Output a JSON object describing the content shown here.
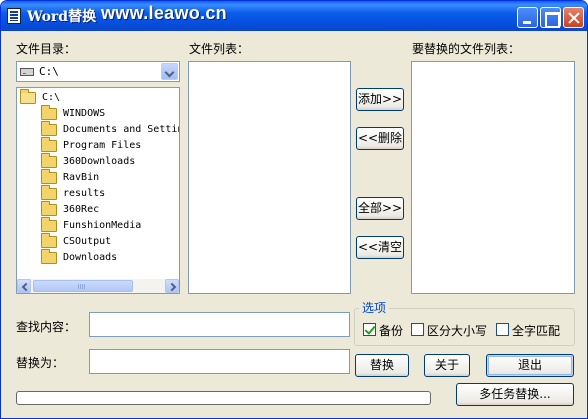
{
  "window": {
    "title": "Word替换",
    "url": "www.leawo.cn"
  },
  "labels": {
    "directory": "文件目录：",
    "file_list": "文件列表：",
    "replace_list": "要替换的文件列表：",
    "find": "查找内容：",
    "replace_with": "替换为："
  },
  "drive_combo": {
    "value": "C:\\"
  },
  "tree": {
    "root": "C:\\",
    "items": [
      "WINDOWS",
      "Documents and Settin",
      "Program Files",
      "360Downloads",
      "RavBin",
      "results",
      "360Rec",
      "FunshionMedia",
      "CSOutput",
      "Downloads"
    ]
  },
  "buttons": {
    "add": "添加>>",
    "remove": "<<删除",
    "all": "全部>>",
    "clear": "<<清空",
    "replace": "替换",
    "about": "关于",
    "exit": "退出",
    "multi": "多任务替换..."
  },
  "options": {
    "title": "选项",
    "backup": "备份",
    "backup_checked": true,
    "case_sensitive": "区分大小写",
    "case_checked": false,
    "whole_word": "全字匹配",
    "whole_checked": false
  },
  "inputs": {
    "find_value": "",
    "replace_value": ""
  },
  "progress": {
    "percent": 0
  }
}
